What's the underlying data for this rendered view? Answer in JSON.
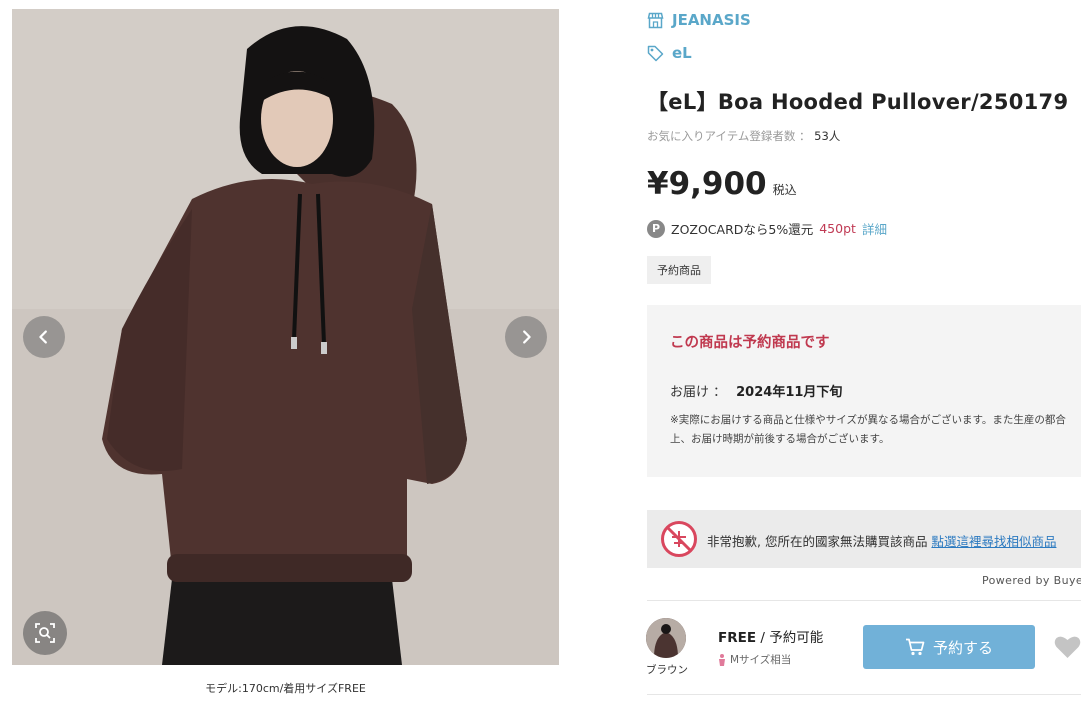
{
  "gallery": {
    "caption": "モデル:170cm/着用サイズFREE",
    "prev_icon": "chevron-left-icon",
    "next_icon": "chevron-right-icon",
    "zoom_icon": "zoom-search-icon"
  },
  "product": {
    "brand": "JEANASIS",
    "brand_icon": "store-icon",
    "label": "eL",
    "label_icon": "tag-icon",
    "title": "【eL】Boa Hooded Pullover/250179",
    "favorites_label": "お気に入りアイテム登録者数 ：",
    "favorites_count": "53人",
    "price": "¥9,900",
    "tax_label": "税込",
    "points_badge": "P",
    "points_prefix": "ZOZOCARDなら5%還元",
    "points_value": "450pt",
    "points_detail": "詳細",
    "preorder_badge": "予約商品"
  },
  "reservation": {
    "title": "この商品は予約商品です",
    "delivery_label": "お届け ：",
    "delivery_value": "2024年11月下旬",
    "note": "※実際にお届けする商品と仕様やサイズが異なる場合がございます。また生産の都合上、お届け時期が前後する場合がございます。"
  },
  "buyee": {
    "message": "非常抱歉, 您所在的國家無法購買該商品",
    "link": "點選這裡尋找相似商品",
    "powered_by": "Powered by Buyee",
    "icon": "restricted-icon"
  },
  "variant": {
    "color_name": "ブラウン",
    "size": "FREE",
    "separator": "/",
    "availability": "予約可能",
    "fit_note": "Mサイズ相当",
    "fit_icon": "person-icon",
    "cart_label": "予約する",
    "cart_icon": "cart-icon",
    "favorite_icon": "heart-icon"
  },
  "colors": {
    "brand_blue": "#5aa7c9",
    "alert_red": "#c0394f",
    "button_blue": "#71b1d8"
  }
}
